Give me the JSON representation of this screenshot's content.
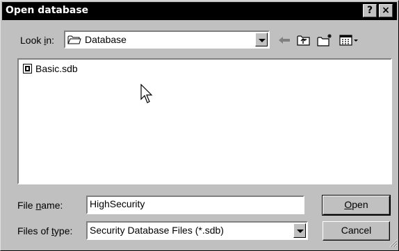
{
  "window": {
    "title": "Open database",
    "help_label": "?",
    "close_label": "×"
  },
  "lookin": {
    "label_pre": "Look ",
    "label_accel": "i",
    "label_post": "n:",
    "value": "Database"
  },
  "toolbar": {
    "icons": [
      "back-arrow-icon",
      "up-folder-icon",
      "new-folder-icon",
      "view-menu-icon"
    ]
  },
  "files": [
    {
      "name": "Basic.sdb",
      "icon": "database-file-icon"
    }
  ],
  "filename": {
    "label_pre": "File ",
    "label_accel": "n",
    "label_post": "ame:",
    "value": "HighSecurity"
  },
  "filetype": {
    "label_pre": "Files of ",
    "label_accel": "t",
    "label_post": "ype:",
    "value": "Security Database Files (*.sdb)"
  },
  "buttons": {
    "open_accel": "O",
    "open_rest": "pen",
    "cancel": "Cancel"
  },
  "colors": {
    "face": "#c0c0c0",
    "titlebar": "#000000",
    "titletext": "#ffffff"
  }
}
